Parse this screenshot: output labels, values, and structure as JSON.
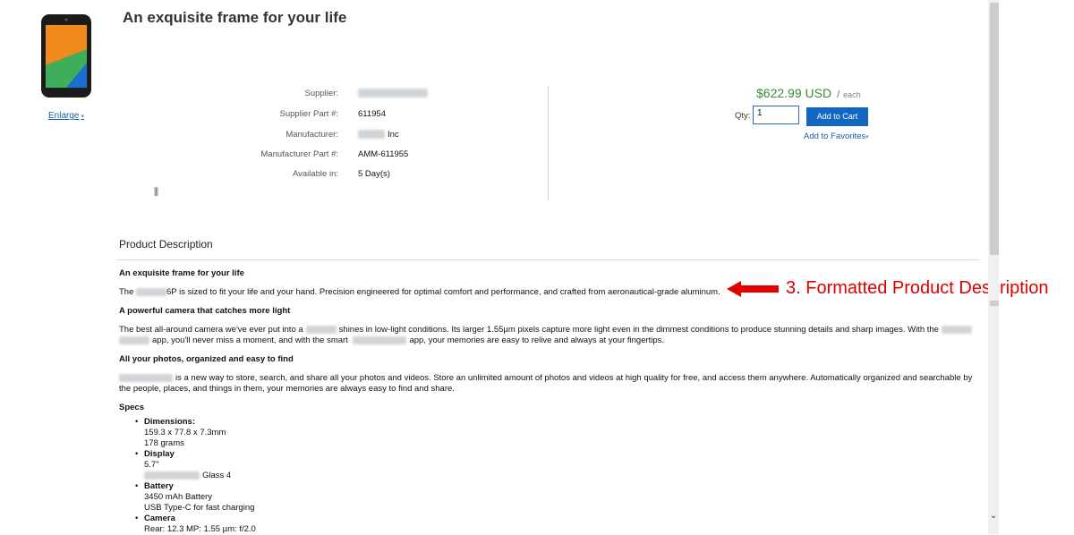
{
  "product": {
    "title": "An exquisite frame for your life",
    "enlarge_label": "Enlarge",
    "details": [
      {
        "label": "Supplier:",
        "value": ""
      },
      {
        "label": "Supplier Part #:",
        "value": "611954"
      },
      {
        "label": "Manufacturer:",
        "value": "Inc"
      },
      {
        "label": "Manufacturer Part #:",
        "value": "AMM-611955"
      },
      {
        "label": "Available in:",
        "value": "5 Day(s)"
      }
    ],
    "small_icon": "barcode-icon"
  },
  "purchase": {
    "price": "$622.99 USD",
    "slash": "/",
    "unit": "each",
    "qty_label": "Qty:",
    "qty_value": "1",
    "add_to_cart": "Add to Cart",
    "add_to_favorites": "Add to Favorites"
  },
  "description": {
    "heading": "Product Description",
    "sections": [
      {
        "title": "An exquisite frame for your life",
        "pre": "The",
        "text": "6P is sized to fit your life  and your hand. Precision engineered for optimal comfort and performance, and crafted from aeronautical-grade aluminum."
      },
      {
        "title": "A powerful camera that catches more light",
        "pre": "The best all-around camera we've ever put into a",
        "text1": "shines in low-light conditions. Its larger 1.55µm pixels capture more light even in the dimmest conditions to produce stunning details and sharp images. With the",
        "text2": "app, you'll never miss a moment, and with the smart",
        "text3": "app, your memories are easy to relive and always at your fingertips."
      },
      {
        "title": "All your photos, organized and easy to find",
        "text": "is a new way to store, search, and share all your photos and videos. Store an unlimited amount of photos and videos at high quality for free, and access them anywhere. Automatically organized and searchable by the people, places, and things in them, your memories are always easy to find and share."
      }
    ],
    "specs_title": "Specs",
    "specs": {
      "dimensions_label": "Dimensions:",
      "dimensions": [
        "159.3 x 77.8 x 7.3mm",
        "178 grams"
      ],
      "display_label": "Display",
      "display": [
        "5.7\"",
        "Glass 4"
      ],
      "battery_label": "Battery",
      "battery": [
        "3450 mAh Battery",
        "USB Type-C for fast charging"
      ],
      "camera_label": "Camera",
      "camera": [
        "Rear: 12.3 MP: 1.55 µm: f/2.0"
      ]
    }
  },
  "annotation": {
    "text": "3. Formatted Product Description",
    "color": "#e00000"
  },
  "scrollbar": {
    "down_icon": "chevron-down-icon"
  }
}
